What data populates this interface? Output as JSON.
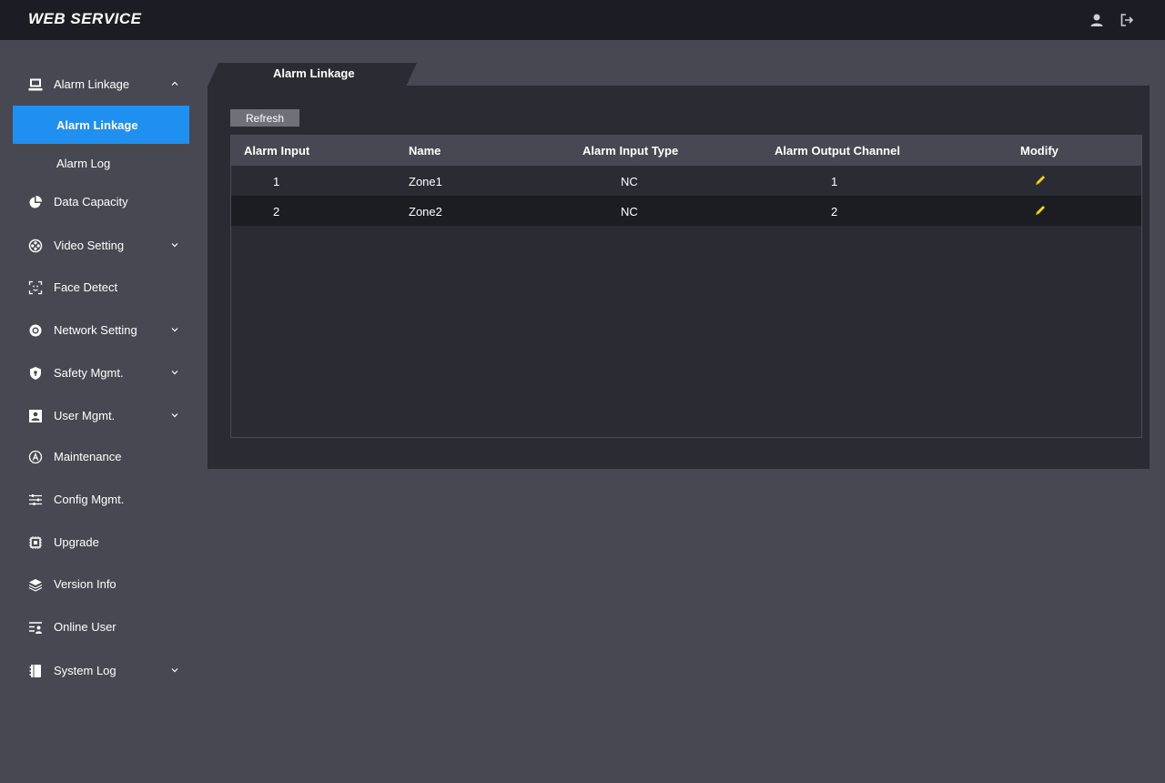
{
  "header": {
    "title": "WEB SERVICE",
    "icons": [
      "user-icon",
      "logout-icon"
    ]
  },
  "sidebar": {
    "items": [
      {
        "label": "Alarm Linkage",
        "icon": "alarm-linkage-icon",
        "expanded": true
      },
      {
        "label": "Alarm Linkage",
        "sub": true,
        "active": true
      },
      {
        "label": "Alarm Log",
        "sub": true
      },
      {
        "label": "Data Capacity",
        "icon": "pie-chart-icon"
      },
      {
        "label": "Video Setting",
        "icon": "video-setting-icon",
        "expandable": true
      },
      {
        "label": "Face Detect",
        "icon": "face-detect-icon"
      },
      {
        "label": "Network Setting",
        "icon": "network-icon",
        "expandable": true
      },
      {
        "label": "Safety Mgmt.",
        "icon": "shield-icon",
        "expandable": true
      },
      {
        "label": "User Mgmt.",
        "icon": "user-card-icon",
        "expandable": true
      },
      {
        "label": "Maintenance",
        "icon": "maintenance-icon"
      },
      {
        "label": "Config Mgmt.",
        "icon": "sliders-icon"
      },
      {
        "label": "Upgrade",
        "icon": "chip-icon"
      },
      {
        "label": "Version Info",
        "icon": "layers-icon"
      },
      {
        "label": "Online User",
        "icon": "online-user-icon"
      },
      {
        "label": "System Log",
        "icon": "log-book-icon",
        "expandable": true
      }
    ]
  },
  "main": {
    "tab": "Alarm Linkage",
    "refresh_label": "Refresh",
    "columns": [
      "Alarm Input",
      "Name",
      "Alarm Input Type",
      "Alarm Output Channel",
      "Modify"
    ],
    "rows": [
      {
        "alarm_input": "1",
        "name": "Zone1",
        "type": "NC",
        "output_channel": "1"
      },
      {
        "alarm_input": "2",
        "name": "Zone2",
        "type": "NC",
        "output_channel": "2"
      }
    ]
  },
  "colors": {
    "accent": "#1f8ff0",
    "background": "#474851",
    "panel": "#2a2b33",
    "topbar": "#1c1d24",
    "edit_icon": "#f5d90a"
  }
}
